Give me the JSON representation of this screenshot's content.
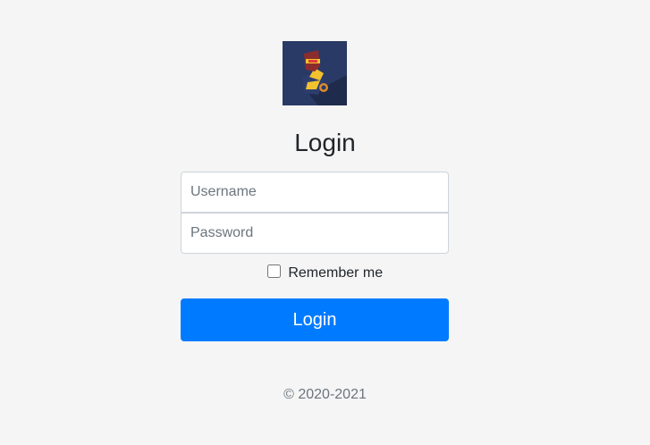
{
  "logo": {
    "icon": "robot-helmet-logo-icon"
  },
  "form": {
    "title": "Login",
    "username_placeholder": "Username",
    "password_placeholder": "Password",
    "remember_label": "Remember me",
    "remember_checked": false,
    "submit_label": "Login"
  },
  "footer": {
    "copyright": "© 2020-2021"
  },
  "colors": {
    "background": "#f5f5f5",
    "primary": "#007bff",
    "logo_bg": "#2a3a66"
  }
}
